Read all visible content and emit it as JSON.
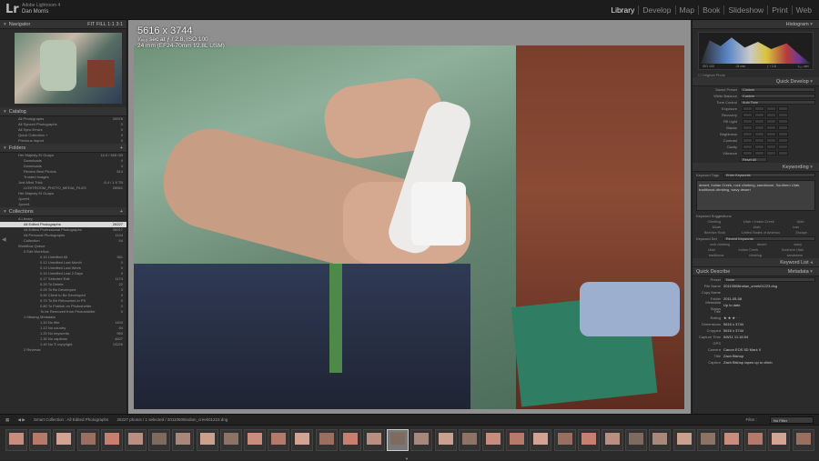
{
  "app": {
    "logo": "Lr",
    "identity_line1": "Adobe Lightroom 4",
    "identity_line2": "Dan Morris"
  },
  "modules": [
    "Library",
    "Develop",
    "Map",
    "Book",
    "Slideshow",
    "Print",
    "Web"
  ],
  "left_panel": {
    "navigator": "Navigator",
    "catalog": {
      "title": "Catalog",
      "items": [
        {
          "label": "All Photographs",
          "count": "29978"
        },
        {
          "label": "All Synced Photographs",
          "count": "0"
        },
        {
          "label": "All Sync Errors",
          "count": "0"
        },
        {
          "label": "Quick Collection +",
          "count": "0"
        },
        {
          "label": "Previous Import",
          "count": "0"
        }
      ]
    },
    "folders": {
      "title": "Folders",
      "items": [
        {
          "label": "Her Majesty El Guapo",
          "count": "14.0 / 465 GB",
          "level": 0
        },
        {
          "label": "Downloads",
          "count": "0",
          "level": 1
        },
        {
          "label": "Downloads",
          "count": "4",
          "level": 1
        },
        {
          "label": "Review Best Photos",
          "count": "814",
          "level": 1
        },
        {
          "label": "Trusted Images",
          "count": "",
          "level": 1
        },
        {
          "label": "Just Mind Trick",
          "count": "8.4 / 1.9 TB",
          "level": 0
        },
        {
          "label": "LIGHTROOM_PHOTO_MEDIA_FILES",
          "count": "28551",
          "level": 1
        },
        {
          "label": "Her Majesty El Guapo",
          "count": "",
          "level": 0
        },
        {
          "label": "Jycret1",
          "count": "",
          "level": 0
        },
        {
          "label": "Jycret1",
          "count": "",
          "level": 0
        }
      ]
    },
    "collections": {
      "title": "Collections",
      "items": [
        {
          "label": "A Library",
          "count": "",
          "level": 0,
          "selected": false
        },
        {
          "label": "All Edited Photographs",
          "count": "26227",
          "level": 1,
          "selected": true
        },
        {
          "label": "All Edited Professional Photographs",
          "count": "26017",
          "level": 1,
          "selected": false
        },
        {
          "label": "All Personal Photographs",
          "count": "1144",
          "level": 1,
          "selected": false
        },
        {
          "label": "Collection",
          "count": "54",
          "level": 1,
          "selected": false
        },
        {
          "label": "Workflow Queue",
          "count": "",
          "level": 0,
          "selected": false
        },
        {
          "label": "0 Edit Workflow",
          "count": "",
          "level": 1,
          "selected": false
        },
        {
          "label": "0.10 Unedited All",
          "count": "381",
          "level": 2,
          "selected": false
        },
        {
          "label": "0.12 Unedited Last Month",
          "count": "0",
          "level": 2,
          "selected": false
        },
        {
          "label": "0.13 Unedited Last Week",
          "count": "0",
          "level": 2,
          "selected": false
        },
        {
          "label": "0.15 Unedited Last 2 Days",
          "count": "0",
          "level": 2,
          "selected": false
        },
        {
          "label": "0.17 Selected Edit",
          "count": "1174",
          "level": 2,
          "selected": false
        },
        {
          "label": "0.20 To Delete",
          "count": "22",
          "level": 2,
          "selected": false
        },
        {
          "label": "0.25 To Be Developed",
          "count": "3",
          "level": 2,
          "selected": false
        },
        {
          "label": "0.60 Client to Be Developed",
          "count": "0",
          "level": 2,
          "selected": false
        },
        {
          "label": "0.70 To Be Retouched in PS",
          "count": "0",
          "level": 2,
          "selected": false
        },
        {
          "label": "0.80 To Publish on Photoshelter",
          "count": "0",
          "level": 2,
          "selected": false
        },
        {
          "label": "To be Removed from Photoshelter",
          "count": "0",
          "level": 2,
          "selected": false
        },
        {
          "label": "1 Missing Metadata",
          "count": "",
          "level": 1,
          "selected": false
        },
        {
          "label": "1.10 No title",
          "count": "1404",
          "level": 2,
          "selected": false
        },
        {
          "label": "1.12 No country",
          "count": "84",
          "level": 2,
          "selected": false
        },
        {
          "label": "1.20 No keywords",
          "count": "960",
          "level": 2,
          "selected": false
        },
        {
          "label": "1.30 No captions",
          "count": "4627",
          "level": 2,
          "selected": false
        },
        {
          "label": "1.40 No © copyright",
          "count": "13226",
          "level": 2,
          "selected": false
        },
        {
          "label": "2 Reviews",
          "count": "",
          "level": 1,
          "selected": false
        }
      ]
    }
  },
  "photo_info": {
    "line1": "5616 x 3744",
    "line2": "¹⁄₄₀₀ sec at ƒ / 2.8, ISO 100",
    "line3": "24 mm (EF24-70mm f/2.8L USM)"
  },
  "right_panel": {
    "histogram": {
      "title": "Histogram",
      "iso": "ISO 100",
      "focal": "24 mm",
      "aperture": "ƒ / 2.8",
      "shutter": "¹⁄₄₀₀ sec",
      "original": "Original Photo"
    },
    "quick_develop": {
      "title": "Quick Develop",
      "saved_preset": {
        "label": "Saved Preset",
        "value": "Custom"
      },
      "white_balance": {
        "label": "White Balance",
        "value": "Custom"
      },
      "tone_control": {
        "label": "Tone Control",
        "value": "Auto Tone"
      },
      "tones": [
        "Exposure",
        "Recovery",
        "Fill Light",
        "Blacks",
        "Brightness",
        "Contrast",
        "Clarity",
        "Vibrance"
      ],
      "reset": "Reset All"
    },
    "keywording": {
      "title": "Keywording",
      "tags_label": "Keyword Tags",
      "tags_value": "Enter Keywords",
      "keywords": "desert, Indian Creek, rock climbing, sandstone, Southern Utah, traditional climbing, wavy desert",
      "suggestions_title": "Keyword Suggestions",
      "suggestions": [
        [
          "Climbing",
          "Utah > Indian Creek",
          "Utah"
        ],
        [
          "Moab",
          "Utah",
          "Ivan"
        ],
        [
          "Beehive Rock",
          "United States of America",
          "Escape"
        ]
      ],
      "set_label": "Keyword Set",
      "set_value": "Recent Keywords",
      "set_items": [
        [
          "rock climbing",
          "desert",
          "wavy"
        ],
        [
          "Utah",
          "Indian Creek",
          "Southern Utah"
        ],
        [
          "traditional",
          "climbing",
          "sandstone"
        ]
      ]
    },
    "keyword_list": "Keyword List",
    "metadata": {
      "title": "Metadata",
      "quick_describe": "Quick Describe",
      "preset_label": "Preset",
      "preset_value": "None",
      "rows": [
        {
          "label": "File Name",
          "value": "20110508indian_creek01223.dng"
        },
        {
          "label": "Copy Name",
          "value": ""
        },
        {
          "label": "Folder",
          "value": "2011-05-08"
        },
        {
          "label": "Metadata Status",
          "value": "Up to date"
        },
        {
          "label": "Title",
          "value": ""
        },
        {
          "label": "Rating",
          "value": "★ ★ ★ · ·"
        },
        {
          "label": "Dimensions",
          "value": "5616 x 3744"
        },
        {
          "label": "Cropped",
          "value": "5616 x 3744"
        },
        {
          "label": "Capture Time",
          "value": "5/8/11 11:18:54"
        },
        {
          "label": "GPS",
          "value": ""
        },
        {
          "label": "Camera",
          "value": "Canon EOS 5D Mark II"
        },
        {
          "label": "Title",
          "value": "Zach Bishop"
        },
        {
          "label": "Caption",
          "value": "Zach Bishop tapes up to climb"
        }
      ]
    }
  },
  "toolbar": {
    "source": "Smart Collection : All Edited Photographs",
    "count": "26227 photos / 1 selected / 20110508indian_creek01223.dng",
    "filter_label": "Filter :",
    "filter_value": "No Filter"
  }
}
